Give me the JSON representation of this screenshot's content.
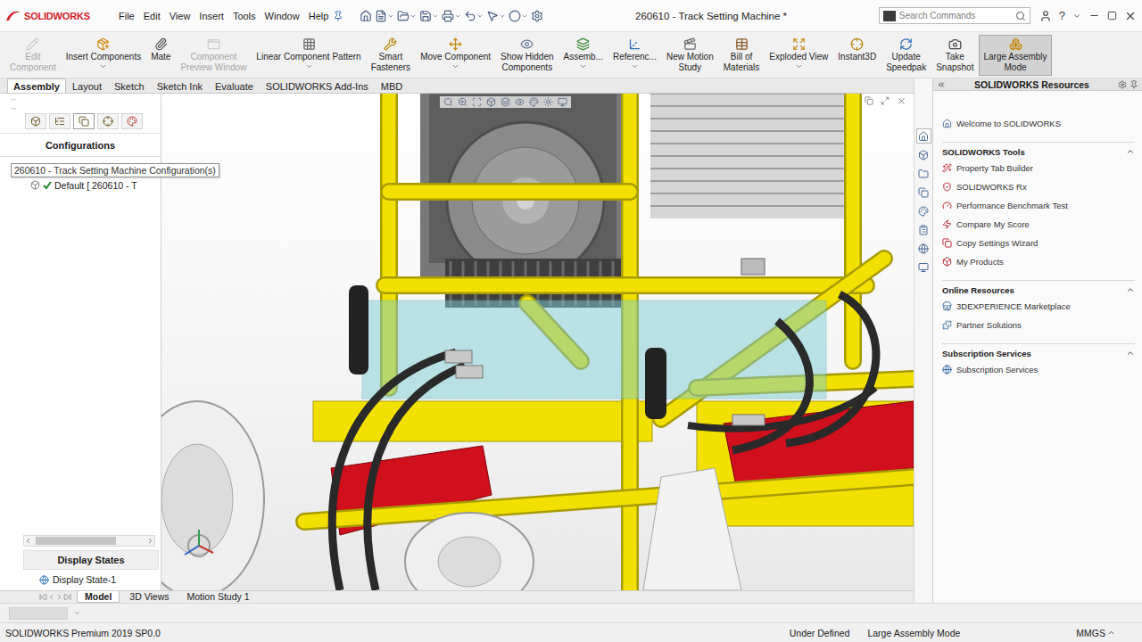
{
  "window": {
    "title": "260610 - Track Setting Machine *",
    "logo": "SOLIDWORKS"
  },
  "menu": [
    "File",
    "Edit",
    "View",
    "Insert",
    "Tools",
    "Window",
    "Help"
  ],
  "search": {
    "placeholder": "Search Commands"
  },
  "help": {
    "label": "?"
  },
  "ribbon": [
    {
      "lines": [
        "Edit",
        "Component"
      ],
      "disabled": true,
      "selected": false,
      "dropdown": false
    },
    {
      "lines": [
        "Insert Components"
      ],
      "disabled": false,
      "selected": false,
      "dropdown": true
    },
    {
      "lines": [
        "Mate"
      ],
      "disabled": false,
      "selected": false,
      "dropdown": false
    },
    {
      "lines": [
        "Component",
        "Preview Window"
      ],
      "disabled": true,
      "selected": false,
      "dropdown": false
    },
    {
      "lines": [
        "Linear Component Pattern"
      ],
      "disabled": false,
      "selected": false,
      "dropdown": true
    },
    {
      "lines": [
        "Smart",
        "Fasteners"
      ],
      "disabled": false,
      "selected": false,
      "dropdown": false
    },
    {
      "lines": [
        "Move Component"
      ],
      "disabled": false,
      "selected": false,
      "dropdown": true
    },
    {
      "lines": [
        "Show Hidden",
        "Components"
      ],
      "disabled": false,
      "selected": false,
      "dropdown": false
    },
    {
      "lines": [
        "Assemb..."
      ],
      "disabled": false,
      "selected": false,
      "dropdown": true
    },
    {
      "lines": [
        "Referenc..."
      ],
      "disabled": false,
      "selected": false,
      "dropdown": true
    },
    {
      "lines": [
        "New Motion",
        "Study"
      ],
      "disabled": false,
      "selected": false,
      "dropdown": false
    },
    {
      "lines": [
        "Bill of",
        "Materials"
      ],
      "disabled": false,
      "selected": false,
      "dropdown": false
    },
    {
      "lines": [
        "Exploded View"
      ],
      "disabled": false,
      "selected": false,
      "dropdown": true
    },
    {
      "lines": [
        "Instant3D"
      ],
      "disabled": false,
      "selected": false,
      "dropdown": false
    },
    {
      "lines": [
        "Update",
        "Speedpak"
      ],
      "disabled": false,
      "selected": false,
      "dropdown": false
    },
    {
      "lines": [
        "Take",
        "Snapshot"
      ],
      "disabled": false,
      "selected": false,
      "dropdown": false
    },
    {
      "lines": [
        "Large Assembly",
        "Mode"
      ],
      "disabled": false,
      "selected": true,
      "dropdown": false
    }
  ],
  "command_tabs": [
    {
      "label": "Assembly",
      "selected": true
    },
    {
      "label": "Layout",
      "selected": false
    },
    {
      "label": "Sketch",
      "selected": false
    },
    {
      "label": "Sketch Ink",
      "selected": false
    },
    {
      "label": "Evaluate",
      "selected": false
    },
    {
      "label": "SOLIDWORKS Add-Ins",
      "selected": false
    },
    {
      "label": "MBD",
      "selected": false
    }
  ],
  "left_panel": {
    "tabs": [
      {
        "selected": false
      },
      {
        "selected": false
      },
      {
        "selected": true
      },
      {
        "selected": false
      },
      {
        "selected": false
      }
    ],
    "header": "Configurations",
    "tree": [
      {
        "label": "260610 - Track Setting Machine Configuration(s)",
        "expanded": true,
        "children": [
          {
            "label": "Default [ 260610 - T",
            "active": true
          }
        ]
      }
    ],
    "display_states": {
      "header": "Display States",
      "items": [
        {
          "label": "Display State-1"
        }
      ]
    }
  },
  "bottom_tabs": [
    {
      "label": "Model",
      "selected": true
    },
    {
      "label": "3D Views",
      "selected": false
    },
    {
      "label": "Motion Study 1",
      "selected": false
    }
  ],
  "task_pane": {
    "title": "SOLIDWORKS Resources",
    "tabs": [
      {
        "selected": true
      },
      {
        "selected": false
      },
      {
        "selected": false
      },
      {
        "selected": false
      },
      {
        "selected": false
      },
      {
        "selected": false
      },
      {
        "selected": false
      },
      {
        "selected": false
      }
    ],
    "welcome": "Welcome to SOLIDWORKS",
    "sections": [
      {
        "title": "SOLIDWORKS Tools",
        "expanded": true,
        "items": [
          "Property Tab Builder",
          "SOLIDWORKS Rx",
          "Performance Benchmark Test",
          "Compare My Score",
          "Copy Settings Wizard",
          "My Products"
        ]
      },
      {
        "title": "Online Resources",
        "expanded": true,
        "items": [
          "3DEXPERIENCE Marketplace",
          "Partner Solutions"
        ]
      },
      {
        "title": "Subscription Services",
        "expanded": true,
        "items": [
          "Subscription Services"
        ]
      }
    ]
  },
  "status_bar": {
    "product": "SOLIDWORKS Premium 2019 SP0.0",
    "items": [
      "Under Defined",
      "Large Assembly Mode",
      "MMGS"
    ]
  }
}
